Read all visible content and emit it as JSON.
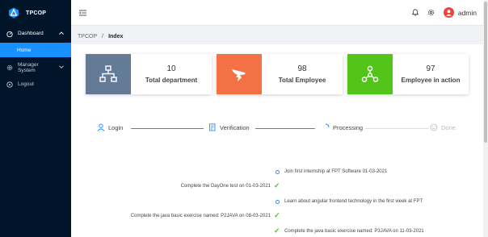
{
  "app": {
    "name": "TPCOP"
  },
  "sidebar": {
    "items": [
      {
        "label": "Dashboard",
        "icon": "dashboard-icon"
      },
      {
        "label": "Home"
      },
      {
        "label": "Manager System",
        "icon": "setting-icon"
      },
      {
        "label": "Logout",
        "icon": "logout-icon"
      }
    ]
  },
  "header": {
    "user": "admin"
  },
  "breadcrumb": {
    "root": "TPCOP",
    "sep": "/",
    "current": "Index"
  },
  "cards": [
    {
      "value": "10",
      "label": "Total department",
      "color": "#637b96",
      "icon": "network-icon"
    },
    {
      "value": "98",
      "label": "Total Employee",
      "color": "#f37144",
      "icon": "dingtalk-icon"
    },
    {
      "value": "97",
      "label": "Employee in action",
      "color": "#52c41a",
      "icon": "share-nodes-icon"
    }
  ],
  "steps": [
    {
      "label": "Login",
      "status": "finish"
    },
    {
      "label": "Verification",
      "status": "finish"
    },
    {
      "label": "Processing",
      "status": "process"
    },
    {
      "label": "Done",
      "status": "wait"
    }
  ],
  "timeline": [
    {
      "text": "Join first internship at FPT Software 01-03-2021",
      "side": "right",
      "mark": "dot"
    },
    {
      "text": "Complete the DayOne test on 01-03-2021",
      "side": "left",
      "mark": "check"
    },
    {
      "text": "Learn about angular frontend technology in the first week at FPT",
      "side": "right",
      "mark": "dot"
    },
    {
      "text": "Complete the java basic exercise named: P2JAVA on 08-03-2021",
      "side": "left",
      "mark": "check"
    },
    {
      "text": "Complete the java basic exercise named: P3JAVA on 11-03-2021",
      "side": "right",
      "mark": "check"
    }
  ]
}
